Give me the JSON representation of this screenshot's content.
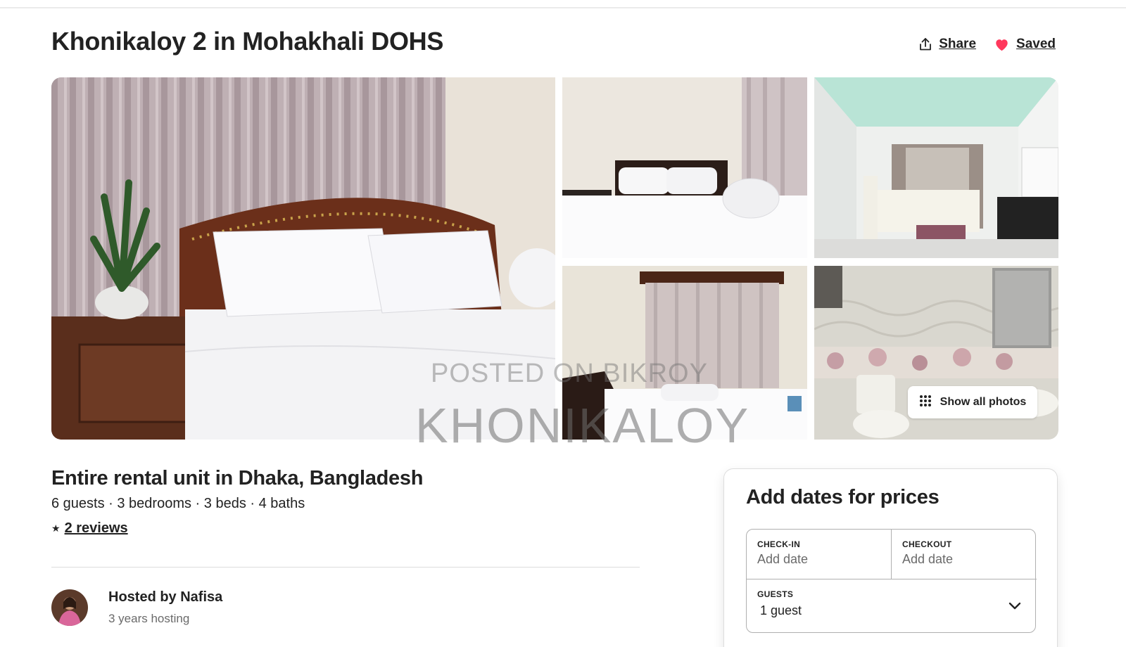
{
  "header": {
    "title": "Khonikaloy 2 in Mohakhali DOHS",
    "share_label": "Share",
    "saved_label": "Saved"
  },
  "gallery": {
    "show_all_label": "Show all photos",
    "watermark_line1": "POSTED ON BIKROY",
    "watermark_line2": "KHONIKALOY"
  },
  "listing": {
    "title": "Entire rental unit in Dhaka, Bangladesh",
    "details": "6 guests · 3 bedrooms · 3 beds · 4 baths",
    "star": "★",
    "reviews_label": "2 reviews"
  },
  "host": {
    "name": "Hosted by Nafisa",
    "meta": "3 years hosting"
  },
  "booking": {
    "title": "Add dates for prices",
    "checkin_label": "CHECK-IN",
    "checkin_value": "Add date",
    "checkout_label": "CHECKOUT",
    "checkout_value": "Add date",
    "guests_label": "GUESTS",
    "guests_value": "1 guest"
  },
  "colors": {
    "text": "#222222",
    "muted": "#6a6a6a",
    "heart": "#ff385c",
    "border": "#dddddd"
  },
  "icons": [
    "share-icon",
    "heart-icon",
    "grid-dots-icon",
    "star-icon",
    "chevron-down-icon"
  ]
}
